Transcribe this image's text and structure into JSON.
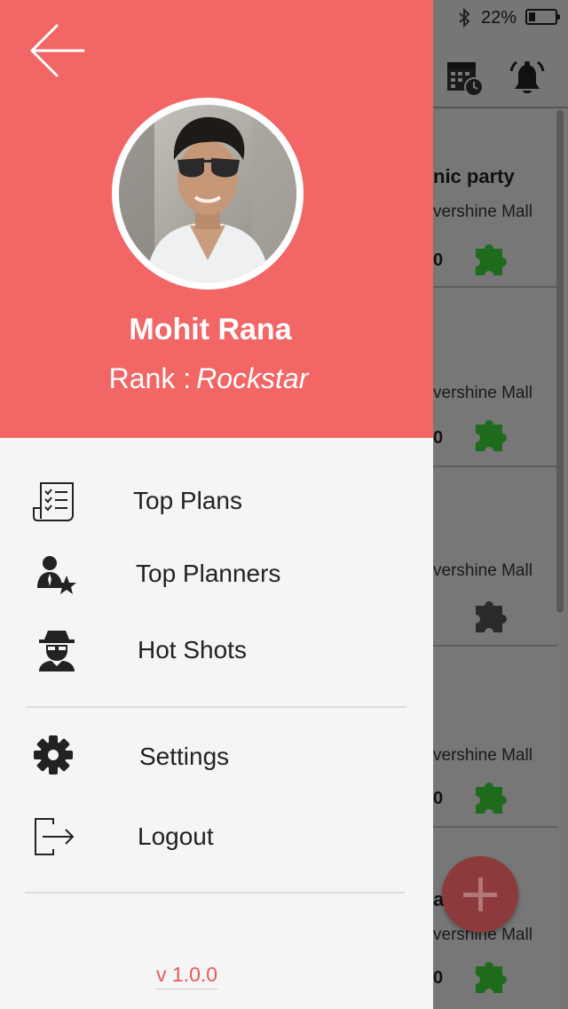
{
  "status_bar": {
    "battery_percent": "22%",
    "battery_level": 0.22
  },
  "background": {
    "cards": [
      {
        "title": "nic party",
        "venue": "vershine Mall",
        "count": "0",
        "puzzle_color": "#1e6b1e"
      },
      {
        "title": "",
        "venue": "vershine Mall",
        "count": "0",
        "puzzle_color": "#1e6b1e"
      },
      {
        "title": "",
        "venue": "vershine Mall",
        "count": "",
        "puzzle_color": "#2a2a2a"
      },
      {
        "title": "",
        "venue": "vershine Mall",
        "count": "0",
        "puzzle_color": "#1e6b1e"
      },
      {
        "title": "ai",
        "venue": "vershine Mall",
        "count": "0",
        "puzzle_color": "#1e6b1e"
      }
    ]
  },
  "drawer": {
    "user": {
      "name": "Mohit Rana",
      "rank_label": "Rank :",
      "rank_value": "Rockstar"
    },
    "menu": [
      {
        "label": "Top Plans",
        "icon": "checklist-icon"
      },
      {
        "label": "Top Planners",
        "icon": "user-star-icon"
      },
      {
        "label": "Hot Shots",
        "icon": "spy-icon"
      },
      {
        "label": "Settings",
        "icon": "gear-icon"
      },
      {
        "label": "Logout",
        "icon": "logout-icon"
      }
    ],
    "version": "v 1.0.0"
  },
  "colors": {
    "header": "#f26666",
    "drawer_bg": "#f5f5f5",
    "version": "#e65a5a",
    "fab": "#e05050"
  }
}
